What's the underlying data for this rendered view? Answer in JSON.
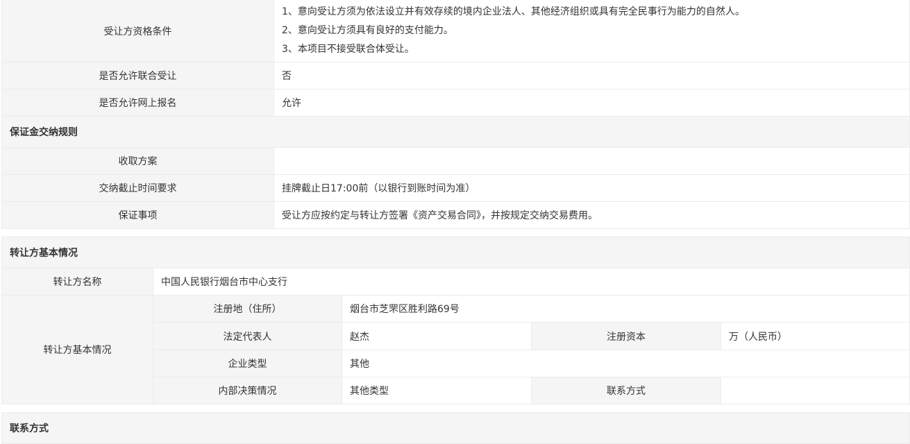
{
  "section_a": {
    "qualification_label": "受让方资格条件",
    "qualification_lines": [
      "1、意向受让方须为依法设立并有效存续的境内企业法人、其他经济组织或具有完全民事行为能力的自然人。",
      "2、意向受让方须具有良好的支付能力。",
      "3、本项目不接受联合体受让。"
    ],
    "joint_label": "是否允许联合受让",
    "joint_value": "否",
    "online_label": "是否允许网上报名",
    "online_value": "允许"
  },
  "deposit": {
    "title": "保证金交纳规则",
    "scheme_label": "收取方案",
    "scheme_value": "",
    "deadline_label": "交纳截止时间要求",
    "deadline_value": "挂牌截止日17:00前（以银行到账时间为准）",
    "guarantee_label": "保证事项",
    "guarantee_value": "受让方应按约定与转让方签署《资产交易合同》，并按规定交纳交易费用。"
  },
  "transferor": {
    "title": "转让方基本情况",
    "name_label": "转让方名称",
    "name_value": "中国人民银行烟台市中心支行",
    "basic_label": "转让方基本情况",
    "address_label": "注册地（住所）",
    "address_value": "烟台市芝罘区胜利路69号",
    "legal_rep_label": "法定代表人",
    "legal_rep_value": "赵杰",
    "capital_label": "注册资本",
    "capital_value": "万（人民币）",
    "type_label": "企业类型",
    "type_value": "其他",
    "decision_label": "内部决策情况",
    "decision_value": "其他类型",
    "contact_label": "联系方式",
    "contact_value": ""
  },
  "contact_section": {
    "title": "联系方式"
  }
}
